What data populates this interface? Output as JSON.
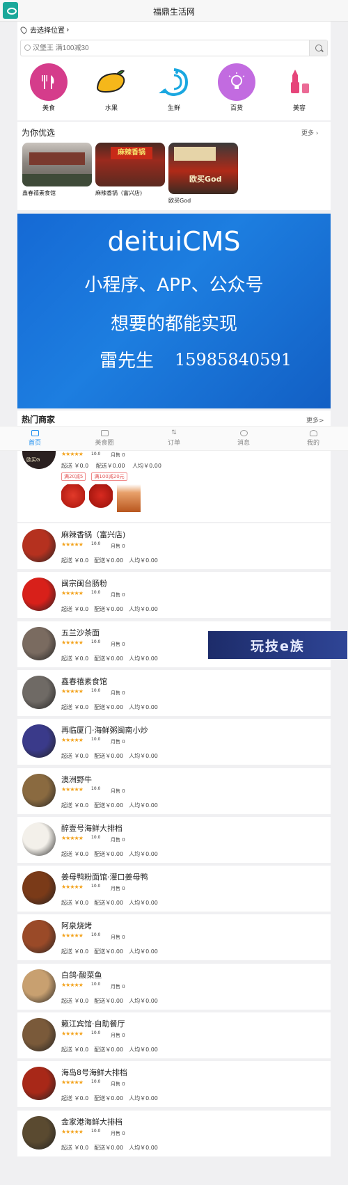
{
  "header": {
    "title": "福鼎生活网"
  },
  "location": {
    "label": "去选择位置"
  },
  "search": {
    "placeholder": "汉堡王 满100减30"
  },
  "categories": [
    {
      "label": "美食",
      "icon": "fork-knife-icon",
      "color": "#d53c8b"
    },
    {
      "label": "水果",
      "icon": "mango-icon",
      "color": "#f2b51c"
    },
    {
      "label": "生鲜",
      "icon": "shrimp-icon",
      "color": "#1aa7e0"
    },
    {
      "label": "百货",
      "icon": "lightbulb-icon",
      "color": "#c26be0"
    },
    {
      "label": "美容",
      "icon": "lipstick-icon",
      "color": "#e6457a"
    }
  ],
  "recommend": {
    "title": "为你优选",
    "more": "更多",
    "items": [
      {
        "name": "鑫春禧素食馆",
        "sign": ""
      },
      {
        "name": "麻辣香锅（富兴店)",
        "sign": "麻辣香锅"
      },
      {
        "name": "欧买God",
        "sign": "欧买God"
      }
    ]
  },
  "banner": {
    "line1": "deituiCMS",
    "line2": "小程序、APP、公众号",
    "line3": "想要的都能实现",
    "contact_name": "雷先生",
    "contact_phone": "15985840591"
  },
  "hot": {
    "title": "热门商家",
    "more": "更多>"
  },
  "tabbar": [
    {
      "label": "首页",
      "icon": "home-icon",
      "active": true
    },
    {
      "label": "美食圈",
      "icon": "album-icon",
      "active": false
    },
    {
      "label": "订单",
      "icon": "order-icon",
      "active": false
    },
    {
      "label": "消息",
      "icon": "message-icon",
      "active": false
    },
    {
      "label": "我的",
      "icon": "user-icon",
      "active": false
    }
  ],
  "first_shop": {
    "avatar_text": "欧买G",
    "stars": "★★★★★",
    "score": "10.0",
    "sold": "月售 0",
    "min": "起送 ￥0.0",
    "fee": "配送￥0.00",
    "avg": "人均￥0.00",
    "coupons": [
      "满20减5",
      "满100减20元"
    ]
  },
  "shops": [
    {
      "name": "麻辣香锅（富兴店)",
      "stars": "★★★★★",
      "score": "10.0",
      "sold": "月售 0",
      "min": "起送 ￥0.0",
      "fee": "配送￥0.00",
      "avg": "人均￥0.00",
      "color": "#b5311f"
    },
    {
      "name": "闽宗闽台肠粉",
      "stars": "★★★★★",
      "score": "10.0",
      "sold": "月售 0",
      "min": "起送 ￥0.0",
      "fee": "配送￥0.00",
      "avg": "人均￥0.00",
      "color": "#d8201a"
    },
    {
      "name": "五兰沙茶面",
      "stars": "★★★★★",
      "score": "10.0",
      "sold": "月售 0",
      "min": "起送 ￥0.0",
      "fee": "配送￥0.00",
      "avg": "人均￥0.00",
      "color": "#7a6b60"
    },
    {
      "name": "鑫春禧素食馆",
      "stars": "★★★★★",
      "score": "10.0",
      "sold": "月售 0",
      "min": "起送 ￥0.0",
      "fee": "配送￥0.00",
      "avg": "人均￥0.00",
      "color": "#6f6a65"
    },
    {
      "name": "再临厦门·海鲜粥闽南小炒",
      "stars": "★★★★★",
      "score": "10.0",
      "sold": "月售 0",
      "min": "起送 ￥0.0",
      "fee": "配送￥0.00",
      "avg": "人均￥0.00",
      "color": "#3a3a8a"
    },
    {
      "name": "澳洲野牛",
      "stars": "★★★★★",
      "score": "10.0",
      "sold": "月售 0",
      "min": "起送 ￥0.0",
      "fee": "配送￥0.00",
      "avg": "人均￥0.00",
      "color": "#8a6a40"
    },
    {
      "name": "醉壹号海鲜大排档",
      "stars": "★★★★★",
      "score": "10.0",
      "sold": "月售 0",
      "min": "起送 ￥0.0",
      "fee": "配送￥0.00",
      "avg": "人均￥0.00",
      "color": "#f3f0ea"
    },
    {
      "name": "姜母鸭粉面馆·灌口姜母鸭",
      "stars": "★★★★★",
      "score": "10.0",
      "sold": "月售 0",
      "min": "起送 ￥0.0",
      "fee": "配送￥0.00",
      "avg": "人均￥0.00",
      "color": "#7a3a18"
    },
    {
      "name": "阿泉烧烤",
      "stars": "★★★★★",
      "score": "10.0",
      "sold": "月售 0",
      "min": "起送 ￥0.0",
      "fee": "配送￥0.00",
      "avg": "人均￥0.00",
      "color": "#9a4a28"
    },
    {
      "name": "白鸽·酸菜鱼",
      "stars": "★★★★★",
      "score": "10.0",
      "sold": "月售 0",
      "min": "起送 ￥0.0",
      "fee": "配送￥0.00",
      "avg": "人均￥0.00",
      "color": "#c8a070"
    },
    {
      "name": "籁江宾馆·自助餐厅",
      "stars": "★★★★★",
      "score": "10.0",
      "sold": "月售 0",
      "min": "起送 ￥0.0",
      "fee": "配送￥0.00",
      "avg": "人均￥0.00",
      "color": "#7a5a3a"
    },
    {
      "name": "海岛8号海鲜大排档",
      "stars": "★★★★★",
      "score": "10.0",
      "sold": "月售 0",
      "min": "起送 ￥0.0",
      "fee": "配送￥0.00",
      "avg": "人均￥0.00",
      "color": "#a82818"
    },
    {
      "name": "金家港海鲜大排档",
      "stars": "★★★★★",
      "score": "10.0",
      "sold": "月售 0",
      "min": "起送 ￥0.0",
      "fee": "配送￥0.00",
      "avg": "人均￥0.00",
      "color": "#5a4a30"
    }
  ],
  "watermark": {
    "text": "玩技e族"
  }
}
